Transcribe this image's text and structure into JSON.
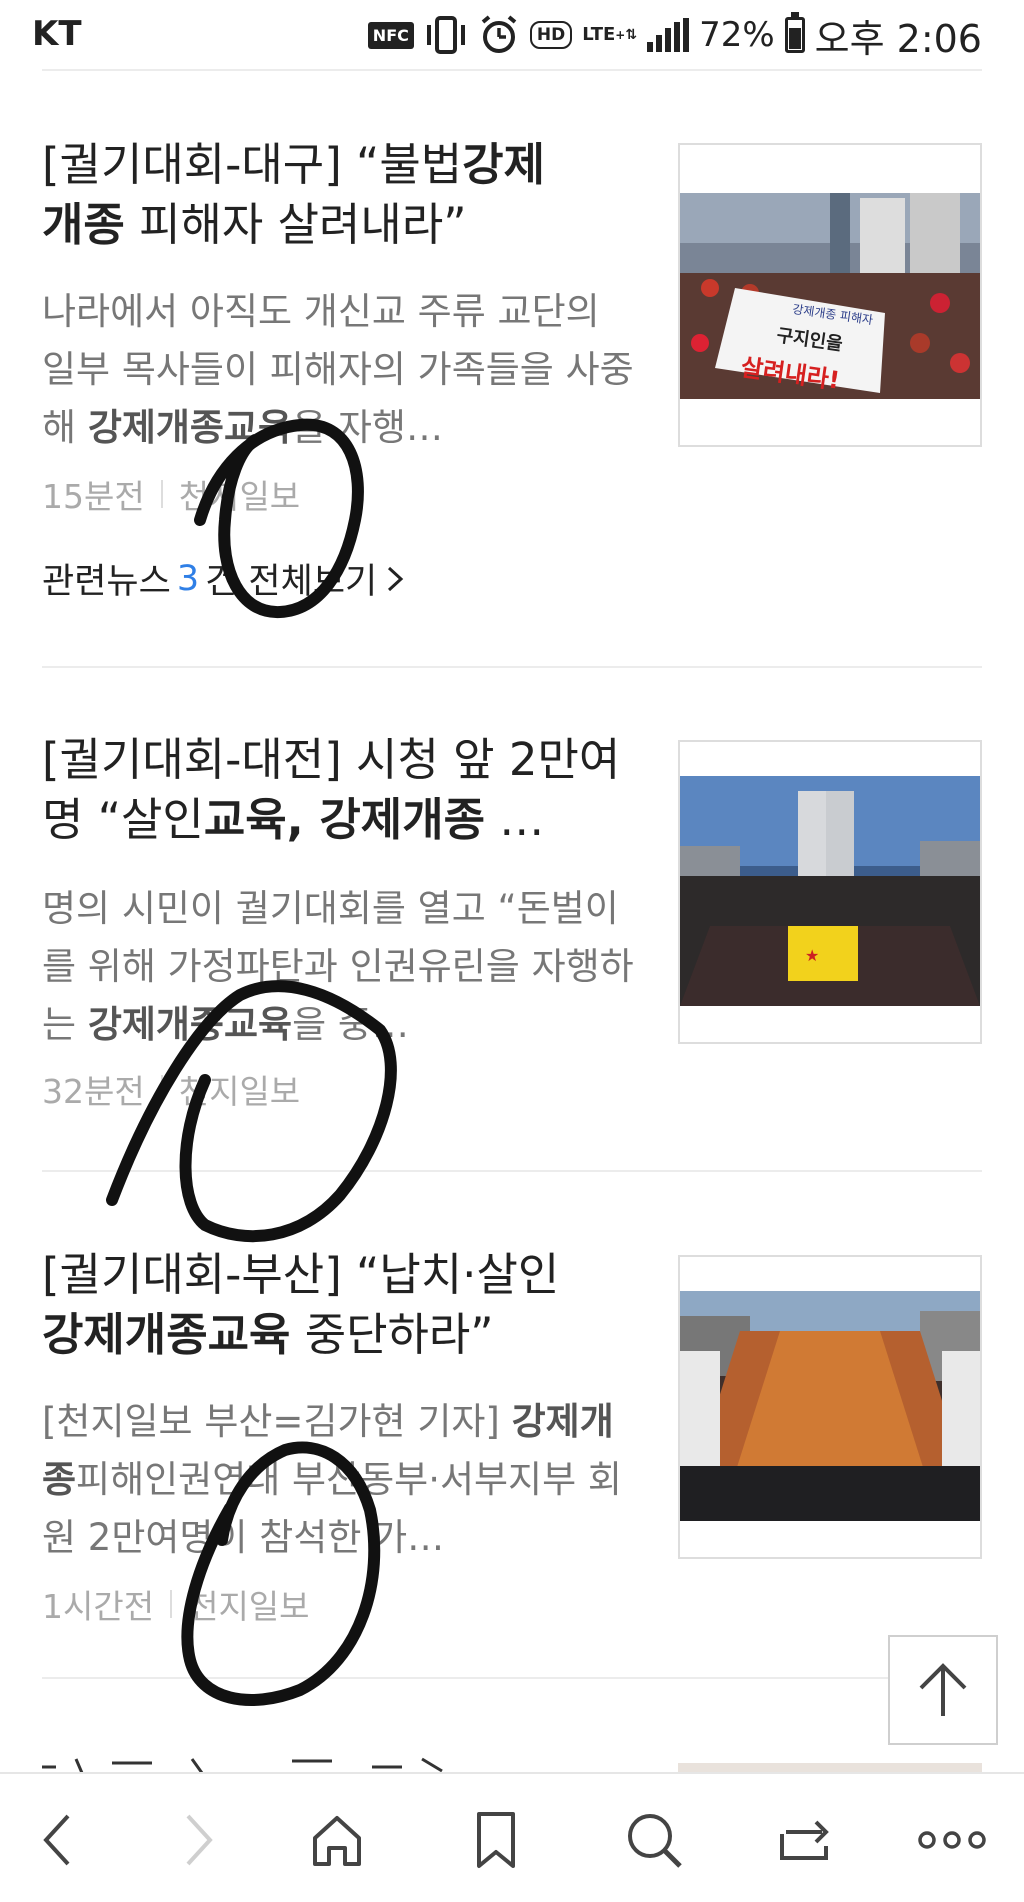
{
  "status_bar": {
    "carrier": "KT",
    "nfc": "NFC",
    "hd": "HD",
    "lte": "LTE",
    "battery": "72%",
    "time": "오후 2:06"
  },
  "articles": [
    {
      "headline_a": "[궐기대회-대구] “불법",
      "headline_b": "강제",
      "headline_c": "개종",
      "headline_d": " 피해자 살려내라”",
      "snippet_a": "나라에서 아직도 개신교 주류 교단의 일부 목사들이 피해자의 가족들을 사중해 ",
      "snippet_b": "강제개종교육",
      "snippet_c": "을 자행…",
      "time": "15분전",
      "source": "천지일보",
      "related_prefix": "관련뉴스",
      "related_count": "3",
      "related_suffix": "건 전체보기",
      "thumb_sign_1": "강제개종 피해자",
      "thumb_sign_2": "구지인을",
      "thumb_sign_3": "살려내라!"
    },
    {
      "headline_a": "[궐기대회-대전] 시청 앞 2만여명 “살인",
      "headline_b": "교육, 강제개종",
      "headline_c": " …",
      "snippet_a": "명의 시민이 궐기대회를 열고 “돈벌이를 위해 가정파탄과 인권유린을 자행하는 ",
      "snippet_b": "강제개종교육",
      "snippet_c": "을 중…",
      "time": "32분전",
      "source": "천지일보"
    },
    {
      "headline_a": "[궐기대회-부산] “납치·살인 ",
      "headline_b": "강제개종교육",
      "headline_c": " 중단하라”",
      "snippet_a": "[천지일보 부산=김가현 기자] ",
      "snippet_b": "강제개종",
      "snippet_c": "피해인권연대 부산동부·서부지부 회원 2만여명이 참석한 가…",
      "time": "1시간전",
      "source": "천지일보"
    }
  ],
  "top_button_icon": "arrow-up-icon",
  "bottom_nav": [
    "back-icon",
    "forward-icon",
    "home-icon",
    "bookmark-icon",
    "search-icon",
    "tabs-icon",
    "more-icon"
  ]
}
